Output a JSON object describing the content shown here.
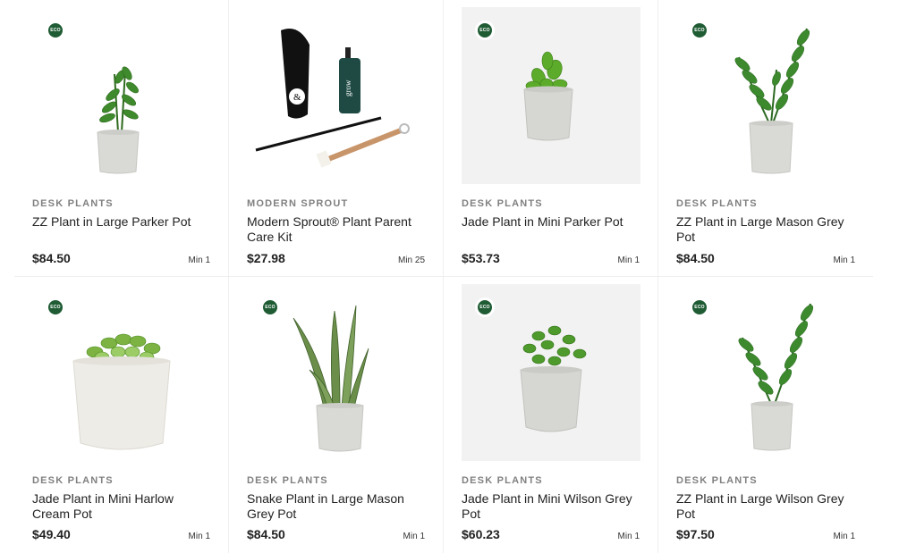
{
  "badge_label": "ECO",
  "products": [
    {
      "category": "DESK PLANTS",
      "name": "ZZ Plant in Large Parker Pot",
      "price": "$84.50",
      "min": "Min 1",
      "eco": true
    },
    {
      "category": "MODERN SPROUT",
      "name": "Modern Sprout® Plant Parent Care Kit",
      "price": "$27.98",
      "min": "Min 25",
      "eco": false,
      "kit_text": "grow"
    },
    {
      "category": "DESK PLANTS",
      "name": "Jade Plant in Mini Parker Pot",
      "price": "$53.73",
      "min": "Min 1",
      "eco": true
    },
    {
      "category": "DESK PLANTS",
      "name": "ZZ Plant in Large Mason Grey Pot",
      "price": "$84.50",
      "min": "Min 1",
      "eco": true
    },
    {
      "category": "DESK PLANTS",
      "name": "Jade Plant in Mini Harlow Cream Pot",
      "price": "$49.40",
      "min": "Min 1",
      "eco": true
    },
    {
      "category": "DESK PLANTS",
      "name": "Snake Plant in Large Mason Grey Pot",
      "price": "$84.50",
      "min": "Min 1",
      "eco": true
    },
    {
      "category": "DESK PLANTS",
      "name": "Jade Plant in Mini Wilson Grey Pot",
      "price": "$60.23",
      "min": "Min 1",
      "eco": true
    },
    {
      "category": "DESK PLANTS",
      "name": "ZZ Plant in Large Wilson Grey Pot",
      "price": "$97.50",
      "min": "Min 1",
      "eco": true
    }
  ],
  "colors": {
    "eco_badge": "#1f5c34",
    "category_text": "#808080",
    "leaf": "#3f8a2c",
    "pot_grey": "#d9d9d6",
    "pot_cream": "#eeece6"
  }
}
